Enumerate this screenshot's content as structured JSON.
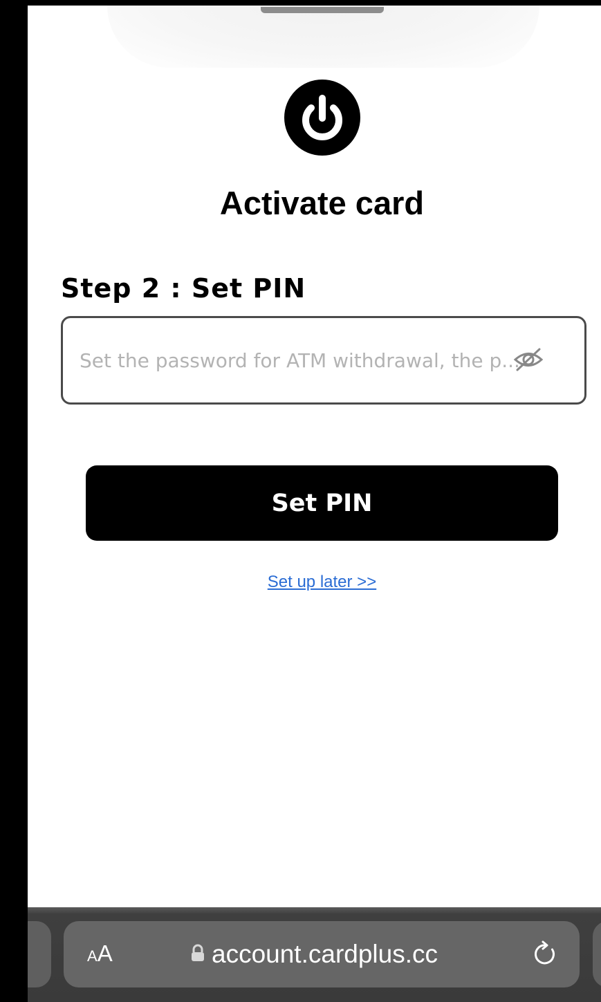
{
  "page": {
    "title": "Activate card",
    "step_label": "Step 2 : Set PIN",
    "pin_field": {
      "placeholder": "Set the password for ATM withdrawal, the p...",
      "value": ""
    },
    "primary_button_label": "Set PIN",
    "skip_link_label": "Set up later >>"
  },
  "icons": {
    "logo": "power-icon",
    "visibility_toggle": "eye-slash-icon",
    "lock": "lock-icon",
    "reload": "reload-icon"
  },
  "browser": {
    "reader_small": "A",
    "reader_big": "A",
    "url": "account.cardplus.cc"
  },
  "colors": {
    "primary_button": "#000000",
    "link": "#2a6cd4",
    "browser_bar": "#3a3a3a"
  }
}
